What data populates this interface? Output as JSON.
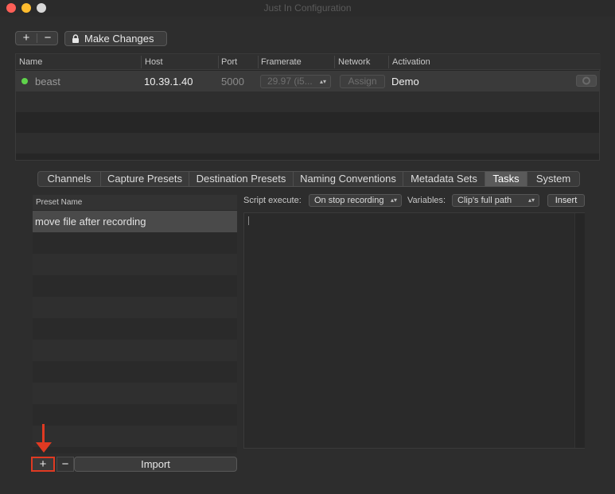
{
  "window": {
    "title": "Just In Configuration"
  },
  "toolbar": {
    "plus": "+",
    "minus": "−",
    "make_changes": "Make Changes"
  },
  "table": {
    "headers": [
      "Name",
      "Host",
      "Port",
      "Framerate",
      "Network",
      "Activation"
    ],
    "row": {
      "name": "beast",
      "host": "10.39.1.40",
      "port": "5000",
      "framerate": "29.97 (i5...",
      "network": "Assign",
      "activation": "Demo",
      "status_color": "#5fd34b"
    }
  },
  "tabs": [
    "Channels",
    "Capture Presets",
    "Destination Presets",
    "Naming Conventions",
    "Metadata Sets",
    "Tasks",
    "System"
  ],
  "active_tab": "Tasks",
  "presets": {
    "header": "Preset Name",
    "items": [
      "move file after recording"
    ]
  },
  "script": {
    "execute_label": "Script execute:",
    "execute_value": "On stop recording",
    "variables_label": "Variables:",
    "variables_value": "Clip's full path",
    "insert": "Insert"
  },
  "bottom": {
    "plus": "+",
    "minus": "−",
    "import": "Import"
  },
  "colors": {
    "highlight": "#e03a22"
  }
}
